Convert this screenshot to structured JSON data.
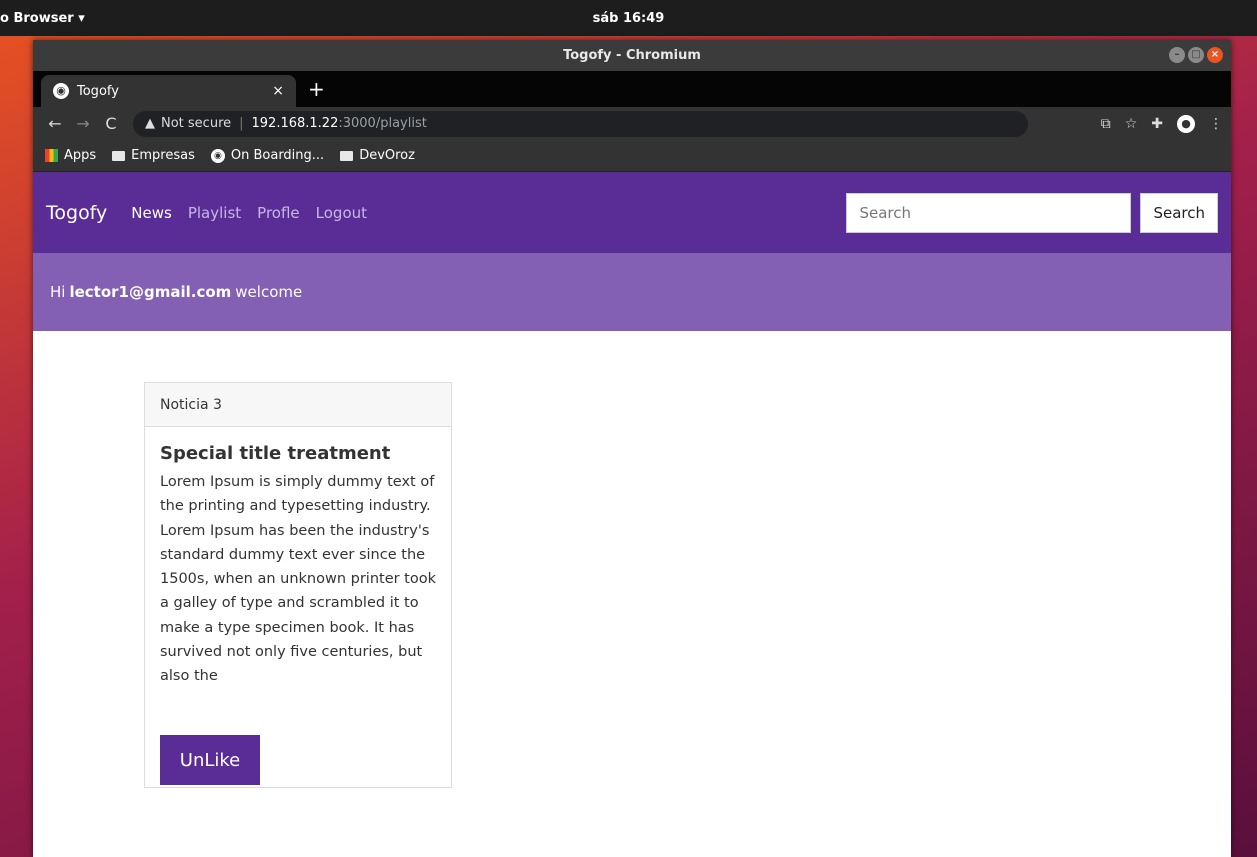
{
  "os": {
    "app_menu": "o Browser ▾",
    "clock": "sáb 16:49"
  },
  "window": {
    "title": "Togofy - Chromium",
    "controls": [
      "–",
      "□",
      "×"
    ]
  },
  "browser": {
    "tab": {
      "title": "Togofy",
      "close": "×"
    },
    "new_tab": "+",
    "back": "←",
    "forward": "→",
    "reload": "C",
    "security": "Not secure",
    "url_host": "192.168.1.22",
    "url_path": ":3000/playlist",
    "toolbar_icons": [
      "translate-icon",
      "star-icon",
      "extensions-icon",
      "profile-icon",
      "menu-icon"
    ],
    "bookmarks": [
      {
        "label": "Apps",
        "icon": "apps-icon"
      },
      {
        "label": "Empresas",
        "icon": "folder-icon"
      },
      {
        "label": "On Boarding...",
        "icon": "globe-icon"
      },
      {
        "label": "DevOroz",
        "icon": "folder-icon"
      }
    ]
  },
  "app": {
    "brand": "Togofy",
    "nav": [
      {
        "label": "News",
        "active": true
      },
      {
        "label": "Playlist",
        "active": false
      },
      {
        "label": "Profle",
        "active": false
      },
      {
        "label": "Logout",
        "active": false
      }
    ],
    "search": {
      "placeholder": "Search",
      "button": "Search"
    },
    "welcome": {
      "prefix": "Hi",
      "email": "lector1@gmail.com",
      "suffix": "welcome"
    },
    "card": {
      "header": "Noticia 3",
      "title": "Special title treatment",
      "text": "Lorem Ipsum is simply dummy text of the printing and typesetting industry. Lorem Ipsum has been the industry's standard dummy text ever since the 1500s, when an unknown printer took a galley of type and scrambled it to make a type specimen book. It has survived not only five centuries, but also the",
      "button": "UnLike"
    },
    "colors": {
      "navbar": "#5a2d96",
      "welcome_bar": "#8460b4",
      "button": "#5a2d96"
    }
  }
}
